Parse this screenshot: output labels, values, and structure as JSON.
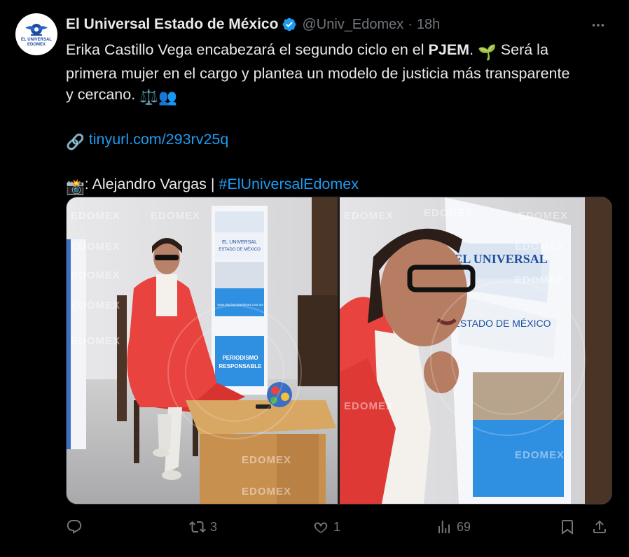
{
  "account": {
    "name": "El Universal Estado de México",
    "handle": "@Univ_Edomex",
    "separator": "·",
    "time": "18h",
    "avatar_text": [
      "EL UNIVERSAL",
      "EDOMEX"
    ]
  },
  "tweet": {
    "line1_pre": "Erika Castillo Vega encabezará el segundo ciclo en el ",
    "line1_bold": "PJEM",
    "line1_post": ". ",
    "line1_emoji": "🌱",
    "line1_tail": " Será la",
    "line2": "primera mujer en el cargo y plantea un modelo de justicia más transparente",
    "line3": "y cercano. ",
    "line3_emojis": "⚖️👥",
    "link_icon": "🔗",
    "link": "tinyurl.com/293rv25q",
    "credit_emoji": "📸",
    "credit_text": ": Alejandro Vargas | ",
    "hashtag": "#ElUniversalEdomex"
  },
  "media": {
    "watermark": "EDOMEX",
    "newspaper_title": "EL UNIVERSAL",
    "newspaper_subtitle": "ESTADO DE MÉXICO",
    "banner_text": [
      "PERIODISMO",
      "RESPONSABLE"
    ],
    "site_text": "www.eluniversaledomex.com.mx"
  },
  "actions": {
    "reply_count": "",
    "retweet_count": "3",
    "like_count": "1",
    "views_count": "69"
  },
  "colors": {
    "background": "#000000",
    "text": "#e7e9ea",
    "muted": "#71767b",
    "link": "#1d9bf0",
    "verified": "#1d9bf0"
  }
}
